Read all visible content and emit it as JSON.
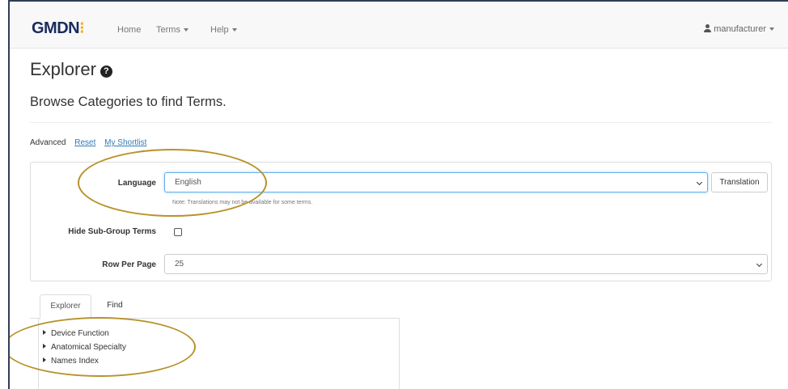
{
  "navbar": {
    "brand_main": "GMDN",
    "brand_mark": "⁝",
    "home": "Home",
    "terms": "Terms",
    "help": "Help",
    "user": "manufacturer"
  },
  "page": {
    "title": "Explorer",
    "help_glyph": "?",
    "subtitle": "Browse Categories to find Terms."
  },
  "actions": {
    "advanced": "Advanced",
    "reset": "Reset",
    "shortlist": "My Shortlist"
  },
  "filters": {
    "language_label": "Language",
    "language_value": "English",
    "translation_button": "Translation",
    "note": "Note: Translations may not be available for some terms.",
    "hide_subgroup_label": "Hide Sub-Group Terms",
    "hide_subgroup_checked": false,
    "rows_label": "Row Per Page",
    "rows_value": "25"
  },
  "tabs": {
    "explorer": "Explorer",
    "find": "Find"
  },
  "tree": {
    "items": [
      "Device Function",
      "Anatomical Specialty",
      "Names Index"
    ]
  },
  "colors": {
    "brand_navy": "#1a2b5e",
    "brand_gold": "#f2b01e",
    "annotation": "#b8922a",
    "link": "#337ab7"
  }
}
